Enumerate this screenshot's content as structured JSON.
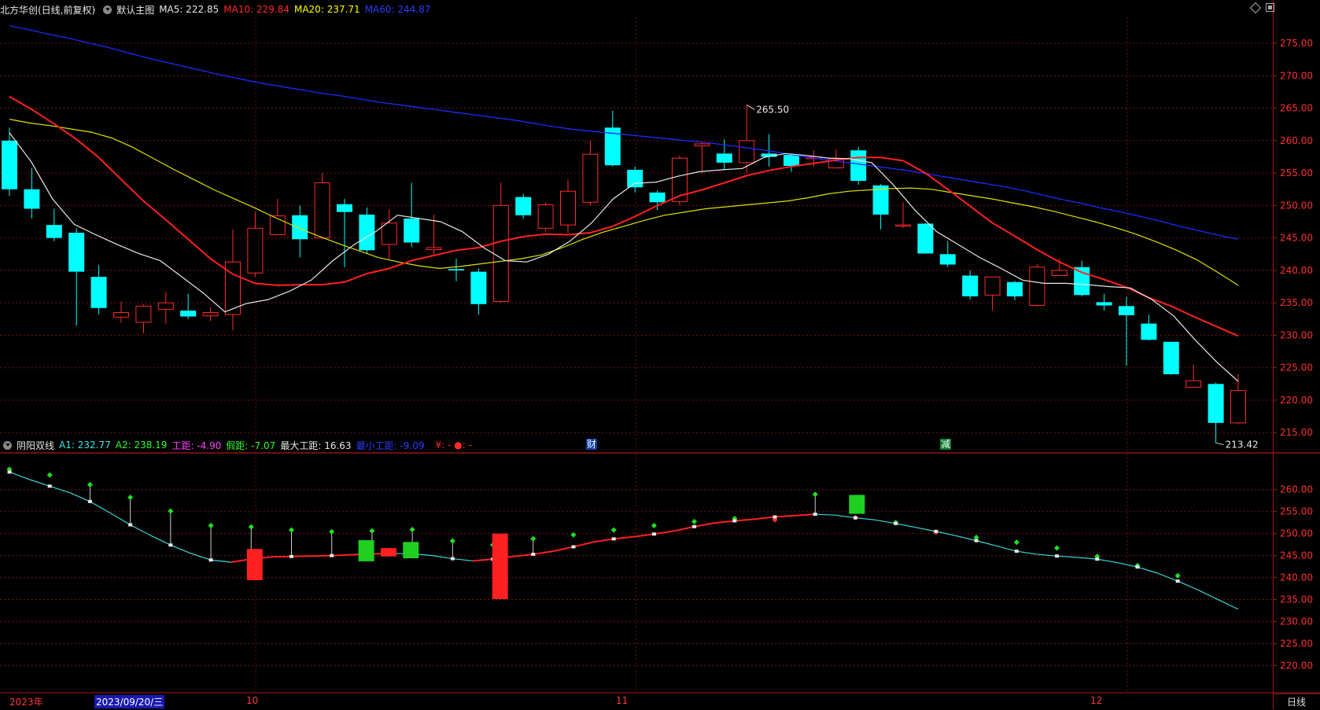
{
  "main_header": {
    "stock": "北方华创(日线,前复权)",
    "template": "默认主图",
    "ma5_label": "MA5:",
    "ma5": "222.85",
    "ma10_label": "MA10:",
    "ma10": "229.84",
    "ma20_label": "MA20:",
    "ma20": "237.71",
    "ma60_label": "MA60:",
    "ma60": "244.87"
  },
  "sub_header": {
    "name": "阴阳双线",
    "a1_label": "A1:",
    "a1": "232.77",
    "a2_label": "A2:",
    "a2": "238.19",
    "gj_label": "工距:",
    "gj": "-4.90",
    "jj_label": "假距:",
    "jj": "-7.07",
    "max_label": "最大工距:",
    "max": "16.63",
    "min_label": "最小工距:",
    "min": "-9.09",
    "extra": "¥: - ●: -"
  },
  "x_axis": {
    "year": "2023年",
    "cursor_date": "2023/09/20/三",
    "m10": "10",
    "m11": "11",
    "m12": "12"
  },
  "period_button": "日线",
  "colors": {
    "up": "#ff2a2a",
    "down": "#00ffff",
    "ma5": "#e8e8e8",
    "ma10": "#ff2020",
    "ma20": "#e0e000",
    "ma60": "#1a2cff"
  },
  "chart_data": [
    {
      "type": "candlestick",
      "title": "北方华创(日线,前复权)",
      "ylim": [
        212,
        279
      ],
      "y_ticks": [
        275,
        270,
        265,
        260,
        255,
        250,
        245,
        240,
        235,
        230,
        225,
        220,
        215
      ],
      "y_tick_labels": [
        "275.00",
        "270.00",
        "265.00",
        "260.00",
        "255.00",
        "250.00",
        "245.00",
        "240.00",
        "235.00",
        "230.00",
        "225.00",
        "220.00",
        "215.00"
      ],
      "high_marker": "265.50",
      "low_marker": "213.42",
      "event_labels": [
        "财",
        "减"
      ],
      "candles": [
        {
          "o": 260.0,
          "c": 252.5,
          "h": 262.0,
          "l": 251.5
        },
        {
          "o": 252.5,
          "c": 249.5,
          "h": 255.8,
          "l": 248.0
        },
        {
          "o": 247.0,
          "c": 245.0,
          "h": 249.5,
          "l": 244.5
        },
        {
          "o": 245.8,
          "c": 239.8,
          "h": 246.5,
          "l": 231.5
        },
        {
          "o": 239.0,
          "c": 234.2,
          "h": 240.8,
          "l": 233.2
        },
        {
          "o": 232.8,
          "c": 233.5,
          "h": 235.2,
          "l": 231.9
        },
        {
          "o": 232.0,
          "c": 234.5,
          "h": 234.8,
          "l": 230.3
        },
        {
          "o": 234.0,
          "c": 235.0,
          "h": 236.7,
          "l": 231.8
        },
        {
          "o": 233.8,
          "c": 232.9,
          "h": 236.4,
          "l": 232.5
        },
        {
          "o": 233.0,
          "c": 233.5,
          "h": 234.3,
          "l": 232.2
        },
        {
          "o": 233.2,
          "c": 241.3,
          "h": 246.3,
          "l": 230.8
        },
        {
          "o": 239.6,
          "c": 246.5,
          "h": 249.0,
          "l": 239.0
        },
        {
          "o": 245.5,
          "c": 248.4,
          "h": 251.0,
          "l": 245.5
        },
        {
          "o": 248.5,
          "c": 244.8,
          "h": 250.0,
          "l": 242.0
        },
        {
          "o": 245.0,
          "c": 253.5,
          "h": 255.0,
          "l": 244.8
        },
        {
          "o": 250.2,
          "c": 249.0,
          "h": 251.0,
          "l": 240.5
        },
        {
          "o": 248.6,
          "c": 243.1,
          "h": 249.7,
          "l": 242.5
        },
        {
          "o": 244.0,
          "c": 247.3,
          "h": 249.4,
          "l": 241.7
        },
        {
          "o": 248.0,
          "c": 244.3,
          "h": 253.5,
          "l": 243.6
        },
        {
          "o": 243.2,
          "c": 243.5,
          "h": 248.6,
          "l": 242.4
        },
        {
          "o": 240.2,
          "c": 240.0,
          "h": 241.8,
          "l": 238.3
        },
        {
          "o": 239.8,
          "c": 234.8,
          "h": 240.3,
          "l": 233.2
        },
        {
          "o": 235.2,
          "c": 250.0,
          "h": 253.5,
          "l": 235.0
        },
        {
          "o": 251.3,
          "c": 248.5,
          "h": 251.8,
          "l": 248.0
        },
        {
          "o": 246.5,
          "c": 250.1,
          "h": 250.5,
          "l": 246.0
        },
        {
          "o": 247.0,
          "c": 252.2,
          "h": 254.0,
          "l": 245.8
        },
        {
          "o": 250.5,
          "c": 257.9,
          "h": 260.0,
          "l": 250.0
        },
        {
          "o": 262.0,
          "c": 256.2,
          "h": 264.6,
          "l": 256.0
        },
        {
          "o": 255.5,
          "c": 252.8,
          "h": 256.0,
          "l": 252.0
        },
        {
          "o": 252.0,
          "c": 250.5,
          "h": 252.3,
          "l": 249.3
        },
        {
          "o": 250.6,
          "c": 257.3,
          "h": 257.7,
          "l": 250.0
        },
        {
          "o": 259.2,
          "c": 259.5,
          "h": 259.8,
          "l": 255.0
        },
        {
          "o": 258.0,
          "c": 256.6,
          "h": 260.2,
          "l": 255.5
        },
        {
          "o": 256.6,
          "c": 260.0,
          "h": 265.5,
          "l": 255.0
        },
        {
          "o": 258.0,
          "c": 257.5,
          "h": 261.0,
          "l": 256.0
        },
        {
          "o": 257.8,
          "c": 256.1,
          "h": 258.0,
          "l": 255.2
        },
        {
          "o": 257.2,
          "c": 257.5,
          "h": 258.5,
          "l": 256.0
        },
        {
          "o": 255.8,
          "c": 257.2,
          "h": 258.6,
          "l": 255.7
        },
        {
          "o": 258.5,
          "c": 253.8,
          "h": 259.0,
          "l": 253.2
        },
        {
          "o": 253.1,
          "c": 248.6,
          "h": 253.3,
          "l": 246.3
        },
        {
          "o": 247.0,
          "c": 247.0,
          "h": 250.5,
          "l": 246.5
        },
        {
          "o": 247.2,
          "c": 242.6,
          "h": 247.3,
          "l": 242.6
        },
        {
          "o": 242.5,
          "c": 240.9,
          "h": 244.5,
          "l": 240.5
        },
        {
          "o": 239.2,
          "c": 236.0,
          "h": 240.0,
          "l": 235.5
        },
        {
          "o": 236.2,
          "c": 239.0,
          "h": 239.0,
          "l": 233.8
        },
        {
          "o": 238.2,
          "c": 236.0,
          "h": 238.4,
          "l": 235.4
        },
        {
          "o": 234.6,
          "c": 240.5,
          "h": 241.0,
          "l": 234.4
        },
        {
          "o": 239.2,
          "c": 240.0,
          "h": 241.8,
          "l": 239.2
        },
        {
          "o": 240.5,
          "c": 236.2,
          "h": 241.5,
          "l": 236.0
        },
        {
          "o": 235.1,
          "c": 234.6,
          "h": 236.4,
          "l": 233.8
        },
        {
          "o": 234.5,
          "c": 233.1,
          "h": 235.9,
          "l": 225.3
        },
        {
          "o": 231.8,
          "c": 229.3,
          "h": 233.2,
          "l": 229.2
        },
        {
          "o": 229.0,
          "c": 224.0,
          "h": 229.0,
          "l": 223.9
        },
        {
          "o": 222.0,
          "c": 223.0,
          "h": 225.5,
          "l": 222.2
        },
        {
          "o": 222.5,
          "c": 216.5,
          "h": 222.7,
          "l": 213.4
        },
        {
          "o": 216.5,
          "c": 221.5,
          "h": 224.0,
          "l": 216.3
        }
      ],
      "ma5": [
        261.2,
        256.8,
        251.0,
        247.1,
        245.5,
        244.0,
        242.6,
        241.5,
        239.0,
        236.5,
        233.6,
        234.9,
        235.5,
        236.8,
        238.5,
        241.5,
        244.0,
        246.0,
        248.5,
        248.0,
        247.5,
        246.0,
        243.5,
        241.5,
        241.3,
        242.5,
        244.5,
        247.3,
        251.0,
        253.4,
        253.6,
        254.5,
        255.2,
        255.5,
        255.7,
        257.4,
        258.0,
        257.7,
        257.3,
        257.2,
        256.6,
        253.2,
        249.3,
        246.0,
        244.0,
        242.0,
        240.3,
        238.5,
        238.0,
        238.0,
        237.8,
        237.5,
        237.3,
        235.5,
        233.0,
        229.3,
        225.9,
        222.9
      ],
      "ma10": [
        266.8,
        264.8,
        262.6,
        260.2,
        257.4,
        254.0,
        250.7,
        247.8,
        244.8,
        241.8,
        239.4,
        238.0,
        237.7,
        237.8,
        237.8,
        238.2,
        239.5,
        240.3,
        241.5,
        242.3,
        243.1,
        243.5,
        244.5,
        245.2,
        245.6,
        245.5,
        245.8,
        246.8,
        248.3,
        250.0,
        251.5,
        252.4,
        253.5,
        254.6,
        255.4,
        256.0,
        256.5,
        257.0,
        257.4,
        257.4,
        256.9,
        255.0,
        252.5,
        249.9,
        247.3,
        245.3,
        243.2,
        241.3,
        239.7,
        238.6,
        237.4,
        235.8,
        234.5,
        232.9,
        231.4,
        229.9
      ],
      "ma20": [
        263.3,
        262.7,
        262.3,
        261.8,
        261.3,
        260.4,
        259.0,
        257.3,
        255.6,
        254.0,
        252.4,
        251.0,
        249.6,
        248.1,
        246.7,
        245.4,
        244.2,
        243.1,
        242.0,
        241.3,
        240.7,
        240.3,
        240.6,
        241.0,
        241.4,
        241.8,
        242.4,
        243.5,
        244.8,
        245.9,
        246.8,
        247.7,
        248.5,
        249.0,
        249.5,
        249.8,
        250.1,
        250.4,
        250.7,
        251.2,
        251.8,
        252.2,
        252.4,
        252.6,
        252.7,
        252.5,
        252.0,
        251.5,
        251.0,
        250.4,
        249.8,
        249.1,
        248.3,
        247.5,
        246.6,
        245.6,
        244.4,
        243.1,
        241.6,
        239.7,
        237.7
      ],
      "ma60": [
        277.7,
        277.1,
        276.4,
        275.8,
        275.1,
        274.4,
        273.6,
        272.8,
        272.1,
        271.4,
        270.7,
        270.0,
        269.4,
        268.8,
        268.3,
        267.8,
        267.3,
        266.9,
        266.4,
        265.9,
        265.5,
        265.1,
        264.7,
        264.3,
        263.9,
        263.5,
        263.1,
        262.6,
        262.1,
        261.7,
        261.4,
        261.1,
        260.8,
        260.5,
        260.2,
        259.9,
        259.6,
        259.2,
        258.8,
        258.4,
        257.9,
        257.4,
        257.0,
        256.6,
        256.2,
        255.8,
        255.4,
        254.9,
        254.4,
        253.9,
        253.4,
        252.9,
        252.3,
        251.6,
        250.9,
        250.3,
        249.6,
        249.0,
        248.3,
        247.6,
        246.8,
        246.1,
        245.4,
        244.8
      ]
    },
    {
      "type": "line",
      "title": "阴阳双线",
      "ylim": [
        214,
        268
      ],
      "y_ticks": [
        260,
        255,
        250,
        245,
        240,
        235,
        230,
        225,
        220
      ],
      "y_tick_labels": [
        "260.00",
        "255.00",
        "250.00",
        "245.00",
        "240.00",
        "235.00",
        "230.00",
        "225.00",
        "220.00"
      ],
      "a1": [
        264.0,
        262.3,
        260.8,
        259.3,
        257.3,
        254.7,
        252.0,
        249.6,
        247.4,
        245.5,
        244.0,
        243.5,
        244.2,
        244.7,
        244.8,
        244.9,
        245.0,
        245.2,
        245.4,
        245.5,
        245.4,
        245.0,
        244.3,
        243.8,
        244.2,
        244.8,
        245.3,
        246.0,
        247.0,
        248.1,
        248.8,
        249.3,
        249.9,
        250.6,
        251.6,
        252.4,
        252.9,
        253.3,
        253.8,
        254.1,
        254.4,
        254.2,
        253.6,
        253.1,
        252.3,
        251.4,
        250.5,
        249.5,
        248.4,
        247.2,
        246.0,
        245.3,
        244.9,
        244.6,
        244.2,
        243.4,
        242.4,
        241.0,
        239.2,
        237.2,
        235.0,
        232.8
      ],
      "a2": [
        264.5,
        264.0,
        263.2,
        262.3,
        261.0,
        259.8,
        258.1,
        256.8,
        255.0,
        253.0,
        251.7,
        251.6,
        251.4,
        250.9,
        250.7,
        250.6,
        250.3,
        250.4,
        250.5,
        250.7,
        250.8,
        249.5,
        248.2,
        247.1,
        247.3,
        248.0,
        248.7,
        249.1,
        249.6,
        250.2,
        250.7,
        251.1,
        251.7,
        252.3,
        252.6,
        253.0,
        253.3,
        253.2,
        253.0,
        253.0,
        258.8,
        254.0,
        253.5,
        252.9,
        252.4,
        251.3,
        250.2,
        249.7,
        249.0,
        248.2,
        247.9,
        247.3,
        246.6,
        245.6,
        244.7,
        243.4,
        242.6,
        241.1,
        240.3,
        238.2
      ]
    }
  ]
}
